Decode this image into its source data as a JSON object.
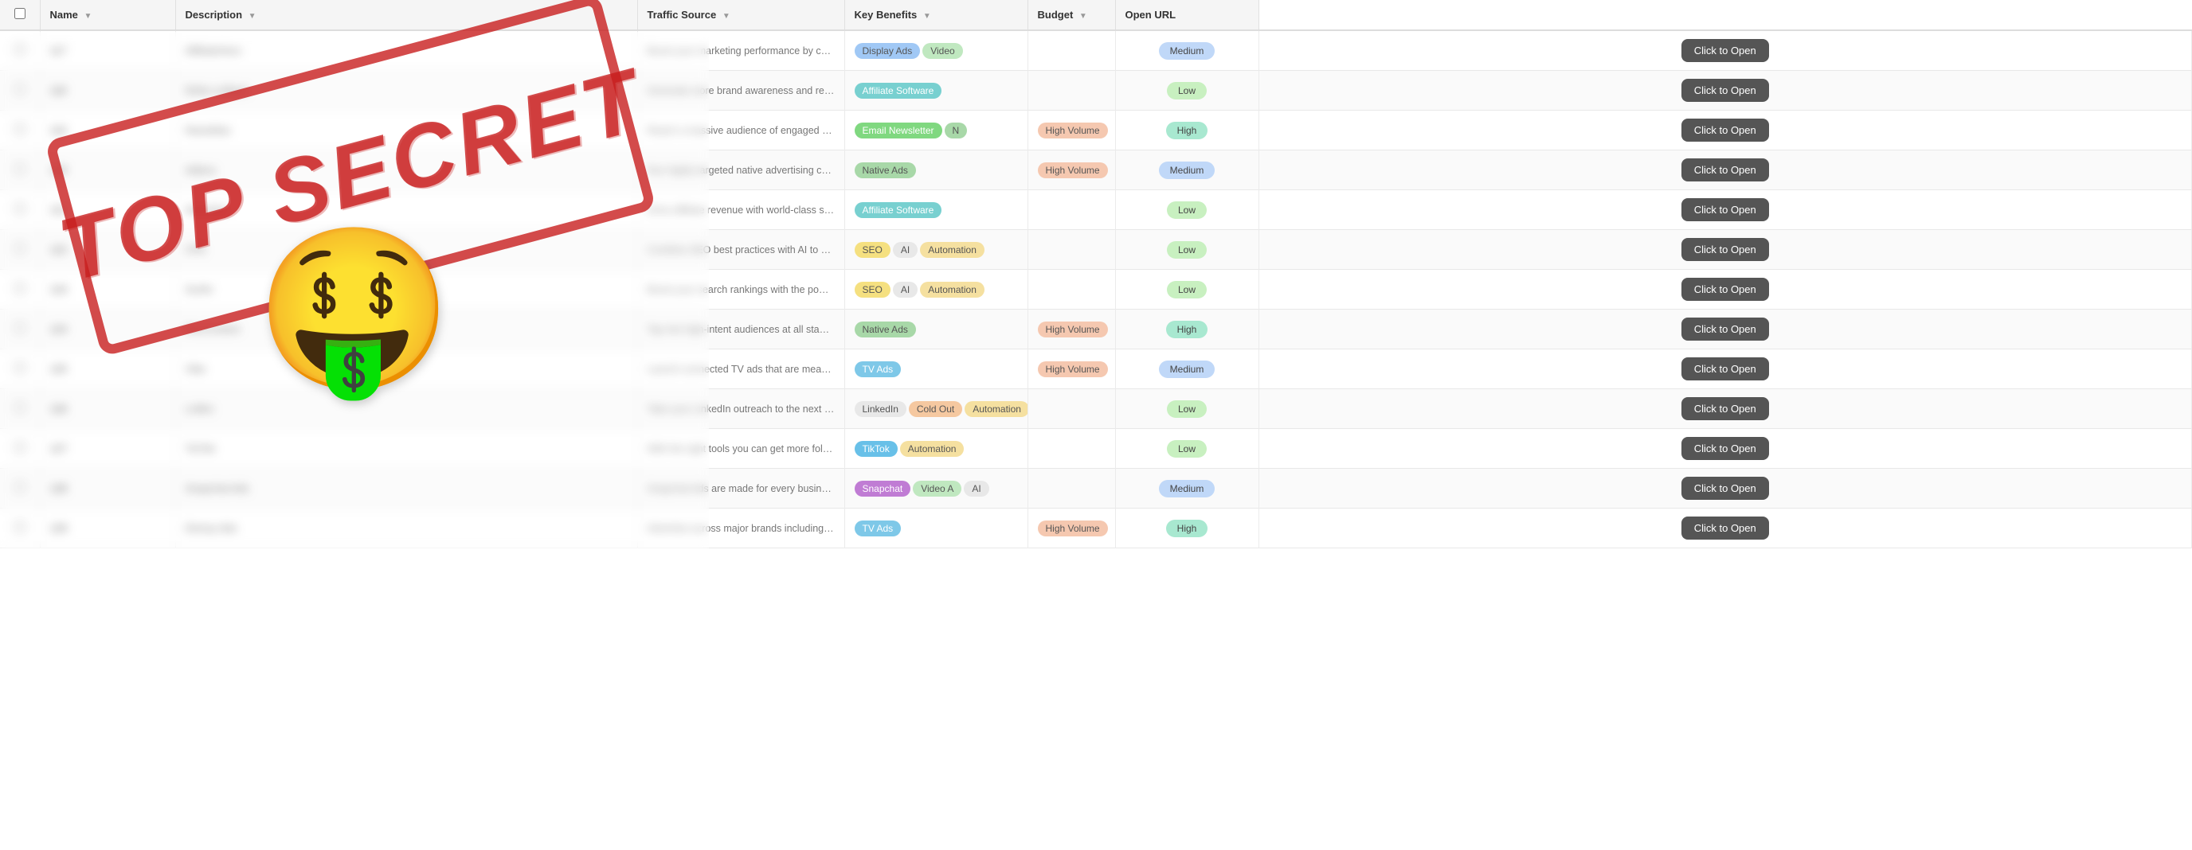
{
  "columns": [
    {
      "id": "checkbox",
      "label": ""
    },
    {
      "id": "name",
      "label": "Name",
      "sortable": true
    },
    {
      "id": "description",
      "label": "Description",
      "sortable": true
    },
    {
      "id": "traffic_source",
      "label": "Traffic Source",
      "sortable": true
    },
    {
      "id": "key_benefits",
      "label": "Key Benefits",
      "sortable": true
    },
    {
      "id": "budget",
      "label": "Budget",
      "sortable": true
    },
    {
      "id": "open_url",
      "label": "Open URL"
    }
  ],
  "rows": [
    {
      "id": 117,
      "name": "AffiliateHero",
      "description": "Boost your marketing performance by combining high-converting affiliate tactics…",
      "traffic_tags": [
        {
          "label": "Display Ads",
          "class": "tag-display"
        },
        {
          "label": "Video",
          "class": "tag-video"
        }
      ],
      "benefit_tags": [],
      "budget": "Medium",
      "budget_class": "budget-medium",
      "btn_label": "Click to Open"
    },
    {
      "id": 118,
      "name": "Refer-a-Black",
      "description": "Generate more brand awareness and referrals with…",
      "traffic_tags": [
        {
          "label": "Affiliate Software",
          "class": "tag-affil"
        }
      ],
      "benefit_tags": [],
      "budget": "Low",
      "budget_class": "budget-low",
      "btn_label": "Click to Open"
    },
    {
      "id": 119,
      "name": "NewsMax",
      "description": "Reach a massive audience of engaged readers with…",
      "traffic_tags": [
        {
          "label": "Email Newsletter",
          "class": "tag-email"
        },
        {
          "label": "N",
          "class": "tag-native"
        }
      ],
      "benefit_tags": [
        {
          "label": "High Volume",
          "class": "tag-highvol"
        }
      ],
      "budget": "High",
      "budget_class": "budget-high",
      "btn_label": "Click to Open"
    },
    {
      "id": 120,
      "name": "Adtera",
      "description": "Run highly targeted native advertising campaigns that…",
      "traffic_tags": [
        {
          "label": "Native Ads",
          "class": "tag-native"
        }
      ],
      "benefit_tags": [
        {
          "label": "High Volume",
          "class": "tag-highvol"
        }
      ],
      "budget": "Medium",
      "budget_class": "budget-medium",
      "btn_label": "Click to Open"
    },
    {
      "id": 121,
      "name": "Advertise",
      "description": "Drive affiliate revenue with world-class software and…",
      "traffic_tags": [
        {
          "label": "Affiliate Software",
          "class": "tag-affil"
        }
      ],
      "benefit_tags": [],
      "budget": "Low",
      "budget_class": "budget-low",
      "btn_label": "Click to Open"
    },
    {
      "id": 122,
      "name": "CPA",
      "description": "Combine SEO best practices with AI to bring in long-term organic and keyword…",
      "traffic_tags": [
        {
          "label": "SEO",
          "class": "tag-seo"
        },
        {
          "label": "AI",
          "class": "tag-ai"
        },
        {
          "label": "Automation",
          "class": "tag-automation"
        }
      ],
      "benefit_tags": [],
      "budget": "Low",
      "budget_class": "budget-low",
      "btn_label": "Click to Open"
    },
    {
      "id": 123,
      "name": "Surfer",
      "description": "Boost your search rankings with the power of AI…",
      "traffic_tags": [
        {
          "label": "SEO",
          "class": "tag-seo"
        },
        {
          "label": "AI",
          "class": "tag-ai"
        },
        {
          "label": "Automation",
          "class": "tag-automation"
        }
      ],
      "benefit_tags": [],
      "budget": "Low",
      "budget_class": "budget-low",
      "btn_label": "Click to Open"
    },
    {
      "id": 124,
      "name": "RevContent",
      "description": "Tap into high-intent audiences at all stages of the marketing…",
      "traffic_tags": [
        {
          "label": "Native Ads",
          "class": "tag-native"
        }
      ],
      "benefit_tags": [
        {
          "label": "High Volume",
          "class": "tag-highvol"
        }
      ],
      "budget": "High",
      "budget_class": "budget-high",
      "btn_label": "Click to Open"
    },
    {
      "id": 125,
      "name": "Vibe",
      "description": "Launch connected TV ads that are measurable, highly targeted TV a…",
      "traffic_tags": [
        {
          "label": "TV Ads",
          "class": "tag-tvads"
        }
      ],
      "benefit_tags": [
        {
          "label": "High Volume",
          "class": "tag-highvol"
        }
      ],
      "budget": "Medium",
      "budget_class": "budget-medium",
      "btn_label": "Click to Open"
    },
    {
      "id": 126,
      "name": "Loften",
      "description": "Take your LinkedIn outreach to the next level and automate…",
      "traffic_tags": [
        {
          "label": "LinkedIn",
          "class": "tag-linkedin"
        },
        {
          "label": "Cold Out",
          "class": "tag-cold"
        },
        {
          "label": "Automation",
          "class": "tag-automation"
        }
      ],
      "benefit_tags": [],
      "budget": "Low",
      "budget_class": "budget-low",
      "btn_label": "Click to Open"
    },
    {
      "id": 127,
      "name": "TieTok",
      "description": "With the right tools you can get more followers, likes…",
      "traffic_tags": [
        {
          "label": "TikTok",
          "class": "tag-tiktok"
        },
        {
          "label": "Automation",
          "class": "tag-automation"
        }
      ],
      "benefit_tags": [],
      "budget": "Low",
      "budget_class": "budget-low",
      "btn_label": "Click to Open"
    },
    {
      "id": 128,
      "name": "Snapchat Ads",
      "description": "Snapchat Ads are made for every business…",
      "traffic_tags": [
        {
          "label": "Snapchat",
          "class": "tag-snapchat"
        },
        {
          "label": "Video A",
          "class": "tag-video"
        },
        {
          "label": "AI",
          "class": "tag-ai"
        }
      ],
      "benefit_tags": [],
      "budget": "Medium",
      "budget_class": "budget-medium",
      "btn_label": "Click to Open"
    },
    {
      "id": 129,
      "name": "Disney Ads",
      "description": "Advertise across major brands including Hulu, ABC, ESPN and…",
      "traffic_tags": [
        {
          "label": "TV Ads",
          "class": "tag-tvads"
        }
      ],
      "benefit_tags": [
        {
          "label": "High Volume",
          "class": "tag-highvol"
        }
      ],
      "budget": "High",
      "budget_class": "budget-high",
      "btn_label": "Click to Open"
    }
  ],
  "overlay": {
    "stamp_text": "TOP SECRET",
    "emoji": "🤑"
  }
}
